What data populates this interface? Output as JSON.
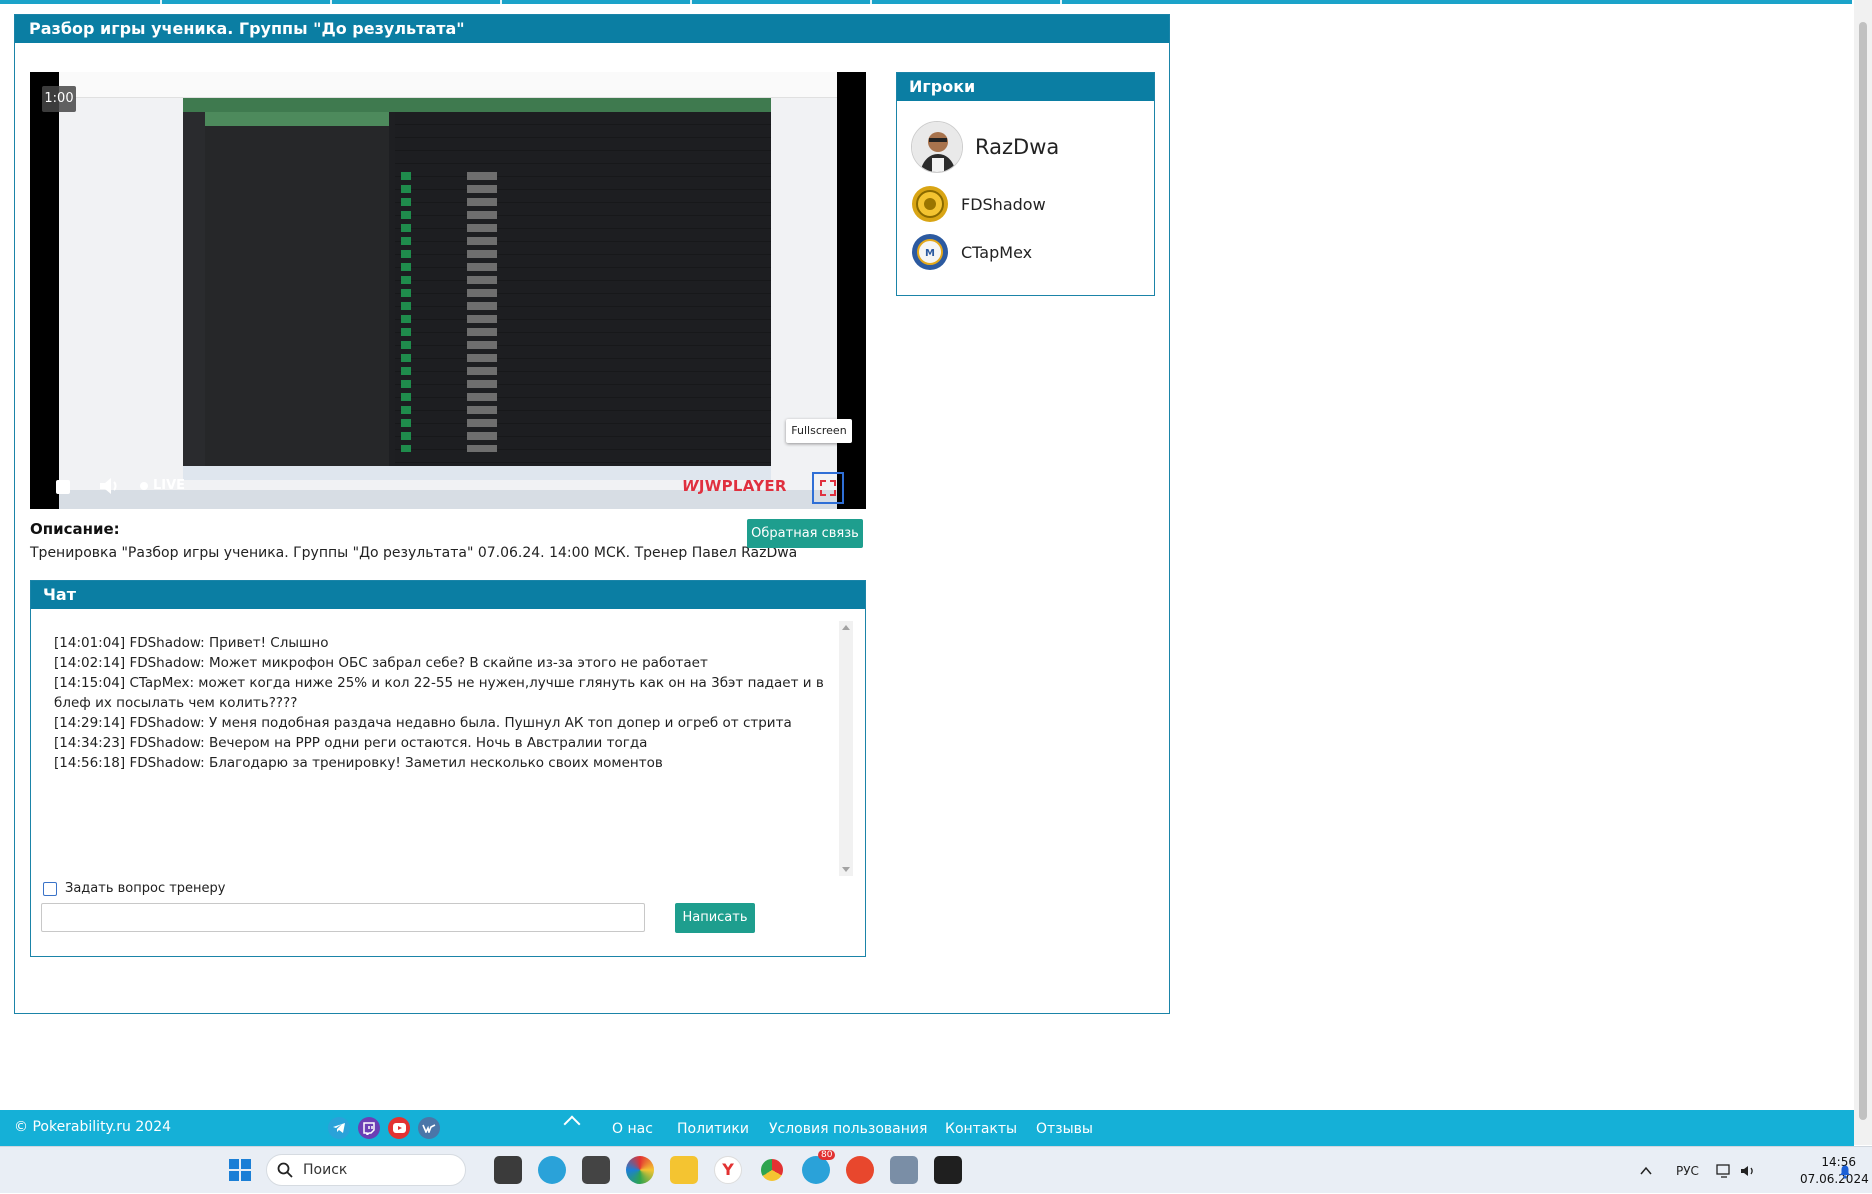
{
  "page": {
    "title": "Разбор игры ученика. Группы \"До результата\""
  },
  "video": {
    "time_badge": "1:00",
    "live_label": "LIVE",
    "player_brand": "JWPLAYER",
    "fullscreen_tooltip": "Fullscreen"
  },
  "players": {
    "title": "Игроки",
    "items": [
      {
        "name": "RazDwa"
      },
      {
        "name": "FDShadow"
      },
      {
        "name": "CTapMex"
      }
    ]
  },
  "description": {
    "title": "Описание:",
    "text": "Тренировка \"Разбор игры ученика. Группы \"До результата\" 07.06.24. 14:00 МСК. Тренер Павел RazDwa",
    "feedback_button": "Обратная связь"
  },
  "chat": {
    "title": "Чат",
    "messages": [
      "[14:01:04] FDShadow: Привет! Слышно",
      "[14:02:14] FDShadow: Может микрофон ОБС забрал себе? В скайпе из-за этого не работает",
      "[14:15:04] CTapMex: может когда ниже 25% и кол 22-55 не нужен,лучше глянуть как он на 3бэт падает и в блеф их посылать чем колить????",
      "[14:29:14] FDShadow: У меня подобная раздача недавно была. Пушнул АК топ допер и огреб от стрита",
      "[14:34:23] FDShadow: Вечером на PPP одни реги остаются. Ночь в Австралии тогда",
      "[14:56:18] FDShadow: Благодарю за тренировку! Заметил несколько своих моментов"
    ],
    "ask_coach_label": "Задать вопрос тренеру",
    "input_value": "",
    "send_button": "Написать"
  },
  "footer": {
    "copyright": "© Pokerability.ru 2024",
    "social": [
      {
        "icon": "telegram-icon",
        "color": "#2aa2d9"
      },
      {
        "icon": "twitch-icon",
        "color": "#6b3fb5"
      },
      {
        "icon": "youtube-icon",
        "color": "#e23232"
      },
      {
        "icon": "vk-icon",
        "color": "#4a76a8"
      }
    ],
    "links": [
      "О нас",
      "Политики",
      "Условия пользования",
      "Контакты",
      "Отзывы"
    ]
  },
  "taskbar": {
    "search_placeholder": "Поиск",
    "language": "РУС",
    "time": "14:56",
    "date": "07.06.2024",
    "badge_count": "80"
  },
  "colors": {
    "header_bg": "#0b7ea3",
    "footer_bg": "#15b0d7",
    "button_bg": "#1e9e8e"
  }
}
